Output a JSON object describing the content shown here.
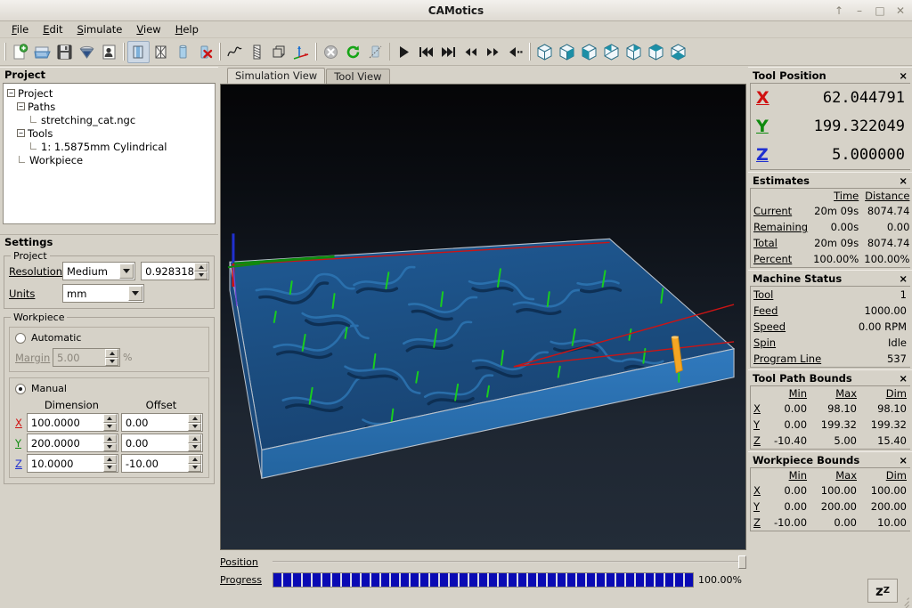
{
  "window": {
    "title": "CAMotics",
    "buttons": [
      {
        "name": "shade-button",
        "glyph": "↑"
      },
      {
        "name": "minimize-button",
        "glyph": "–"
      },
      {
        "name": "maximize-button",
        "glyph": "□"
      },
      {
        "name": "close-button",
        "glyph": "✕"
      }
    ]
  },
  "menubar": {
    "items": [
      {
        "label": "File",
        "mnemonic": "F"
      },
      {
        "label": "Edit",
        "mnemonic": "E"
      },
      {
        "label": "Simulate",
        "mnemonic": "S"
      },
      {
        "label": "View",
        "mnemonic": "V"
      },
      {
        "label": "Help",
        "mnemonic": "H"
      }
    ]
  },
  "toolbar": {
    "groups": [
      {
        "name": "file-group",
        "buttons": [
          {
            "name": "new-project-button",
            "icon": "new-document-icon",
            "active": false
          },
          {
            "name": "open-project-button",
            "icon": "open-folder-icon",
            "active": false
          },
          {
            "name": "save-project-button",
            "icon": "floppy-disk-icon",
            "active": false
          },
          {
            "name": "tool-settings-button",
            "icon": "endmill-cone-icon",
            "active": false
          },
          {
            "name": "examples-button",
            "icon": "document-person-icon",
            "active": false
          }
        ]
      },
      {
        "name": "workpiece-group",
        "buttons": [
          {
            "name": "show-workpiece-button",
            "icon": "workpiece-block-icon",
            "active": true
          },
          {
            "name": "show-wireframe-button",
            "icon": "wireframe-block-icon",
            "active": false
          },
          {
            "name": "show-tool-button",
            "icon": "cylinder-icon",
            "active": false
          },
          {
            "name": "clear-workpiece-button",
            "icon": "cylinder-delete-icon",
            "active": false
          }
        ]
      },
      {
        "name": "display-group",
        "buttons": [
          {
            "name": "show-path-button",
            "icon": "curve-path-icon",
            "active": false
          },
          {
            "name": "show-tool-path-button",
            "icon": "drill-bit-icon",
            "active": false
          },
          {
            "name": "show-bounds-button",
            "icon": "bounding-box-icon",
            "active": false
          },
          {
            "name": "show-axes-button",
            "icon": "axes-icon",
            "active": false
          }
        ]
      },
      {
        "name": "simulation-group",
        "buttons": [
          {
            "name": "stop-button",
            "icon": "stop-circle-icon",
            "active": false
          },
          {
            "name": "reload-button",
            "icon": "reload-circular-arrow-icon",
            "active": false
          },
          {
            "name": "optimize-button",
            "icon": "optimize-cylinder-icon",
            "active": false
          }
        ]
      },
      {
        "name": "playback-group",
        "buttons": [
          {
            "name": "play-button",
            "icon": "play-triangle-icon",
            "active": false
          },
          {
            "name": "skip-start-button",
            "icon": "skip-to-start-icon",
            "active": false
          },
          {
            "name": "skip-end-button",
            "icon": "skip-to-end-icon",
            "active": false
          },
          {
            "name": "step-back-button",
            "icon": "rewind-icon",
            "active": false
          },
          {
            "name": "step-forward-button",
            "icon": "fast-forward-icon",
            "active": false
          },
          {
            "name": "step-left-button",
            "icon": "step-back-dotted-icon",
            "active": false
          }
        ]
      },
      {
        "name": "view-angle-group",
        "buttons": [
          {
            "name": "view-isometric-button",
            "icon": "cube-isometric-icon",
            "active": false
          },
          {
            "name": "view-front-button",
            "icon": "cube-front-icon",
            "active": false
          },
          {
            "name": "view-back-button",
            "icon": "cube-back-icon",
            "active": false
          },
          {
            "name": "view-left-button",
            "icon": "cube-left-icon",
            "active": false
          },
          {
            "name": "view-right-button",
            "icon": "cube-right-icon",
            "active": false
          },
          {
            "name": "view-top-button",
            "icon": "cube-top-icon",
            "active": false
          },
          {
            "name": "view-bottom-button",
            "icon": "cube-bottom-icon",
            "active": false
          }
        ]
      }
    ]
  },
  "project_panel": {
    "title": "Project",
    "close_glyph": "×",
    "tree": [
      {
        "label": "Project",
        "level": 0,
        "toggle": "−"
      },
      {
        "label": "Paths",
        "level": 1,
        "toggle": "−"
      },
      {
        "label": "stretching_cat.ngc",
        "level": 2,
        "toggle": null
      },
      {
        "label": "Tools",
        "level": 1,
        "toggle": "−"
      },
      {
        "label": "1: 1.5875mm Cylindrical",
        "level": 2,
        "toggle": null
      },
      {
        "label": "Workpiece",
        "level": 1,
        "toggle": null
      }
    ]
  },
  "settings_panel": {
    "title": "Settings",
    "project_group": {
      "legend": "Project",
      "resolution_label": "Resolution",
      "resolution_value": "Medium",
      "resolution_number": "0.928318",
      "units_label": "Units",
      "units_value": "mm"
    },
    "workpiece_group": {
      "legend": "Workpiece",
      "automatic_label": "Automatic",
      "automatic_selected": false,
      "margin_label": "Margin",
      "margin_value": "5.00",
      "margin_suffix": "%",
      "manual_label": "Manual",
      "manual_selected": true,
      "dimension_header": "Dimension",
      "offset_header": "Offset",
      "rows": [
        {
          "axis": "X",
          "dimension": "100.0000",
          "offset": "0.00"
        },
        {
          "axis": "Y",
          "dimension": "200.0000",
          "offset": "0.00"
        },
        {
          "axis": "Z",
          "dimension": "10.0000",
          "offset": "-10.00"
        }
      ]
    }
  },
  "center": {
    "tabs": [
      {
        "label": "Simulation View",
        "selected": true
      },
      {
        "label": "Tool View",
        "selected": false
      }
    ],
    "position_label": "Position",
    "progress_label": "Progress",
    "progress_percent": "100.00%",
    "progress_value": 100
  },
  "tool_position": {
    "title": "Tool Position",
    "close_glyph": "×",
    "axes": [
      {
        "axis": "X",
        "value": "62.044791",
        "color": "#d01010"
      },
      {
        "axis": "Y",
        "value": "199.322049",
        "color": "#0e8a0e"
      },
      {
        "axis": "Z",
        "value": "5.000000",
        "color": "#2030d0"
      }
    ]
  },
  "estimates": {
    "title": "Estimates",
    "close_glyph": "×",
    "columns": [
      "Time",
      "Distance"
    ],
    "rows": [
      {
        "label": "Current",
        "time": "20m 09s",
        "distance": "8074.74"
      },
      {
        "label": "Remaining",
        "time": "0.00s",
        "distance": "0.00"
      },
      {
        "label": "Total",
        "time": "20m 09s",
        "distance": "8074.74"
      },
      {
        "label": "Percent",
        "time": "100.00%",
        "distance": "100.00%"
      }
    ]
  },
  "machine_status": {
    "title": "Machine Status",
    "close_glyph": "×",
    "rows": [
      {
        "label": "Tool",
        "value": "1"
      },
      {
        "label": "Feed",
        "value": "1000.00"
      },
      {
        "label": "Speed",
        "value": "0.00 RPM"
      },
      {
        "label": "Spin",
        "value": "Idle"
      },
      {
        "label": "Program Line",
        "value": "537"
      }
    ]
  },
  "tool_path_bounds": {
    "title": "Tool Path Bounds",
    "close_glyph": "×",
    "columns": [
      "Min",
      "Max",
      "Dim"
    ],
    "rows": [
      {
        "axis": "X",
        "min": "0.00",
        "max": "98.10",
        "dim": "98.10"
      },
      {
        "axis": "Y",
        "min": "0.00",
        "max": "199.32",
        "dim": "199.32"
      },
      {
        "axis": "Z",
        "min": "-10.40",
        "max": "5.00",
        "dim": "15.40"
      }
    ]
  },
  "workpiece_bounds": {
    "title": "Workpiece Bounds",
    "close_glyph": "×",
    "columns": [
      "Min",
      "Max",
      "Dim"
    ],
    "rows": [
      {
        "axis": "X",
        "min": "0.00",
        "max": "100.00",
        "dim": "100.00"
      },
      {
        "axis": "Y",
        "min": "0.00",
        "max": "200.00",
        "dim": "200.00"
      },
      {
        "axis": "Z",
        "min": "-10.00",
        "max": "0.00",
        "dim": "10.00"
      }
    ]
  },
  "sleep_button": {
    "name": "sleep-button",
    "label": "z",
    "sup": "Z"
  },
  "colors": {
    "axis_x": "#d01010",
    "axis_y": "#0e8a0e",
    "axis_z": "#2030d0",
    "workpiece_top": "#1d4e84",
    "workpiece_side": "#2a6cae",
    "tool": "#f5a623",
    "rapid_move": "#cc1414",
    "cut_move": "#18d018",
    "progress_bar": "#0a0ab4"
  }
}
